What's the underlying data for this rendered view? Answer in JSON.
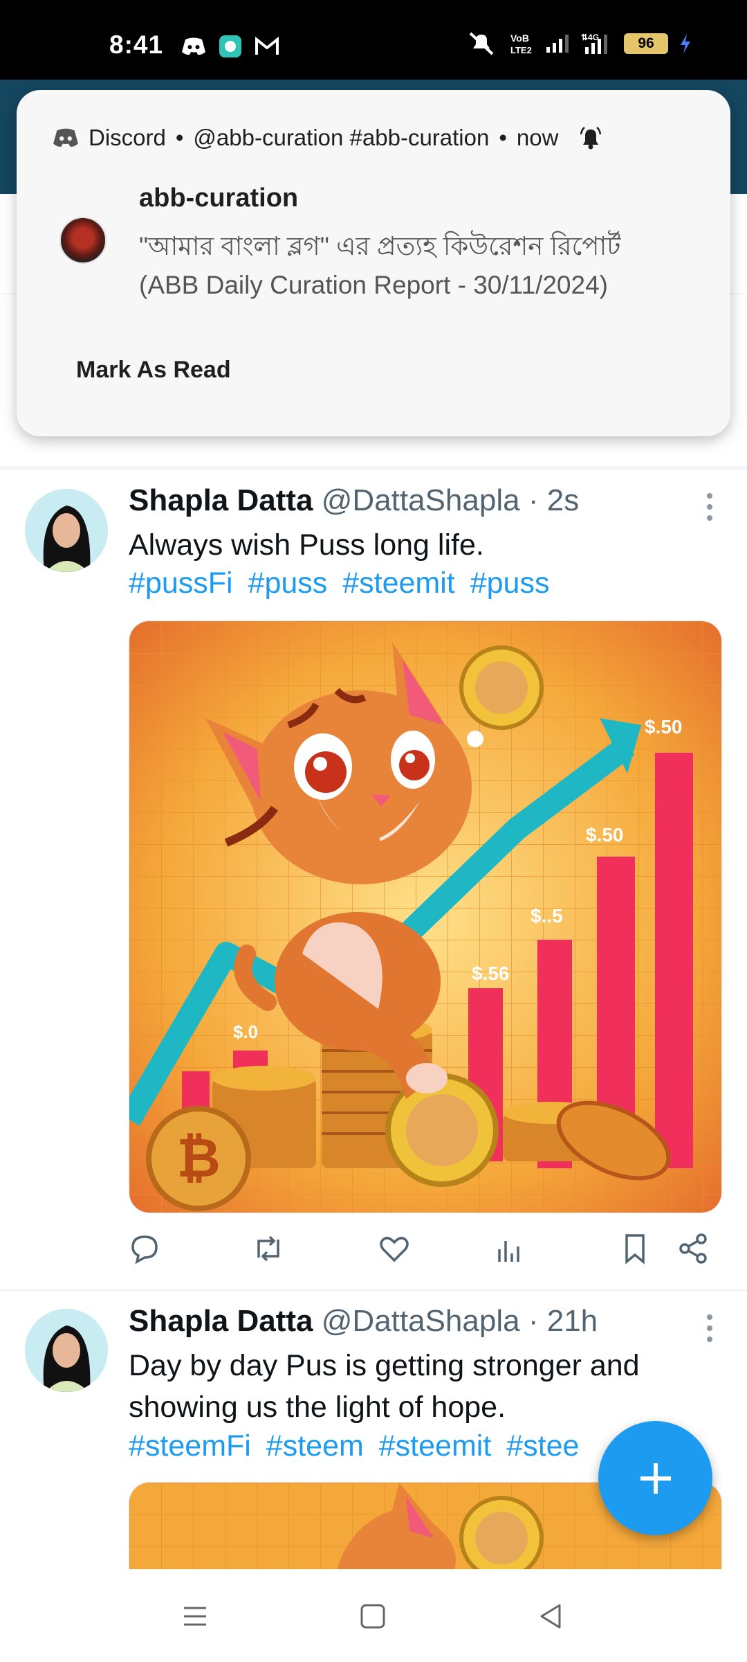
{
  "status_bar": {
    "time": "8:41",
    "battery": "96"
  },
  "notification": {
    "app": "Discord",
    "source": "@abb-curation #abb-curation",
    "time": "now",
    "title": "abb-curation",
    "body_line1": "\"আমার বাংলা ব্লগ\" এর প্রত্যহ কিউরেশন রিপোর্ট",
    "body_line2": "(ABB Daily Curation Report - 30/11/2024)",
    "action": "Mark As Read"
  },
  "tweets": [
    {
      "name": "Shapla Datta",
      "handle": "@DattaShapla",
      "time": "2s",
      "text": "Always wish Puss long life.",
      "hashtags": [
        "#pussFi",
        "#puss",
        "#steemit",
        "#puss"
      ],
      "image_labels": [
        "$.50",
        "$.50",
        "$..5",
        "$.56",
        "$.0"
      ]
    },
    {
      "name": "Shapla Datta",
      "handle": "@DattaShapla",
      "time": "21h",
      "text_line1": "Day by day Pus is getting stronger and",
      "text_line2": "showing us the light of hope.",
      "hashtags": [
        "#steemFi",
        "#steem",
        "#steemit",
        "#stee"
      ]
    }
  ]
}
